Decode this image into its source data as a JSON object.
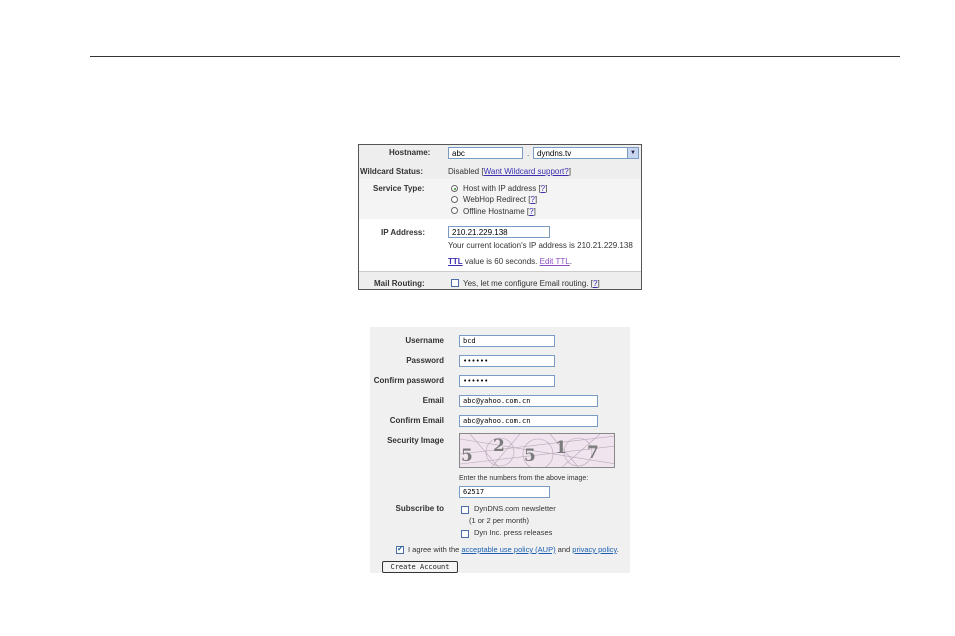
{
  "panel1": {
    "hostname": {
      "label": "Hostname:",
      "value": "abc",
      "dot": ".",
      "domain": "dyndns.tv"
    },
    "wildcard": {
      "label": "Wildcard Status:",
      "status": "Disabled",
      "open": "[",
      "link": "Want Wildcard support?",
      "close": "]"
    },
    "service": {
      "label": "Service Type:",
      "options": [
        {
          "label": "Host with IP address",
          "help": "?",
          "selected": true
        },
        {
          "label": "WebHop Redirect",
          "help": "?",
          "selected": false
        },
        {
          "label": "Offline Hostname",
          "help": "?",
          "selected": false
        }
      ]
    },
    "ip": {
      "label": "IP Address:",
      "value": "210.21.229.138",
      "note": "Your current location's IP address is 210.21.229.138",
      "ttl_link": "TTL",
      "ttl_text": " value is 60 seconds. ",
      "edit_link": "Edit TTL",
      "period": "."
    },
    "mail": {
      "label": "Mail Routing:",
      "option": "Yes, let me configure Email routing.",
      "help": "?"
    }
  },
  "panel2": {
    "username": {
      "label": "Username",
      "value": "bcd"
    },
    "password": {
      "label": "Password",
      "value": "••••••"
    },
    "confirm_password": {
      "label": "Confirm password",
      "value": "••••••"
    },
    "email": {
      "label": "Email",
      "value": "abc@yahoo.com.cn"
    },
    "confirm_email": {
      "label": "Confirm Email",
      "value": "abc@yahoo.com.cn"
    },
    "security": {
      "label": "Security Image",
      "digits": [
        "5",
        "2",
        "5",
        "1",
        "7"
      ],
      "prompt": "Enter the numbers from the above image:",
      "value": "62517"
    },
    "subscribe": {
      "label": "Subscribe to",
      "newsletter": "DynDNS.com newsletter",
      "newsletter_note": "(1 or 2 per month)",
      "press": "Dyn Inc. press releases"
    },
    "agree": {
      "prefix": "I agree with the ",
      "aup_link": "acceptable use policy (AUP)",
      "mid": " and ",
      "privacy_link": "privacy policy",
      "suffix": "."
    },
    "create_button": "Create Account"
  }
}
